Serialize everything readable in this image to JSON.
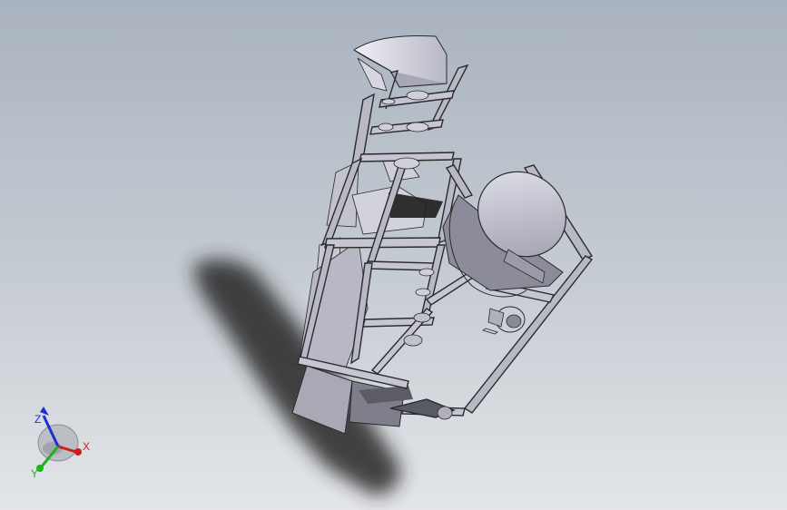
{
  "triad": {
    "x_label": "X",
    "y_label": "Y",
    "z_label": "Z",
    "x_color": "#d01c1c",
    "y_color": "#1fb21f",
    "z_color": "#1c2fd0"
  },
  "colors": {
    "background_top": "#a9b3bf",
    "background_bottom": "#e3e5e8",
    "frame_edge": "#2a2a2a",
    "part_face": "#c9c9d6",
    "part_face_dark": "#8e8e9c",
    "shadow": "#2b2b2b"
  }
}
